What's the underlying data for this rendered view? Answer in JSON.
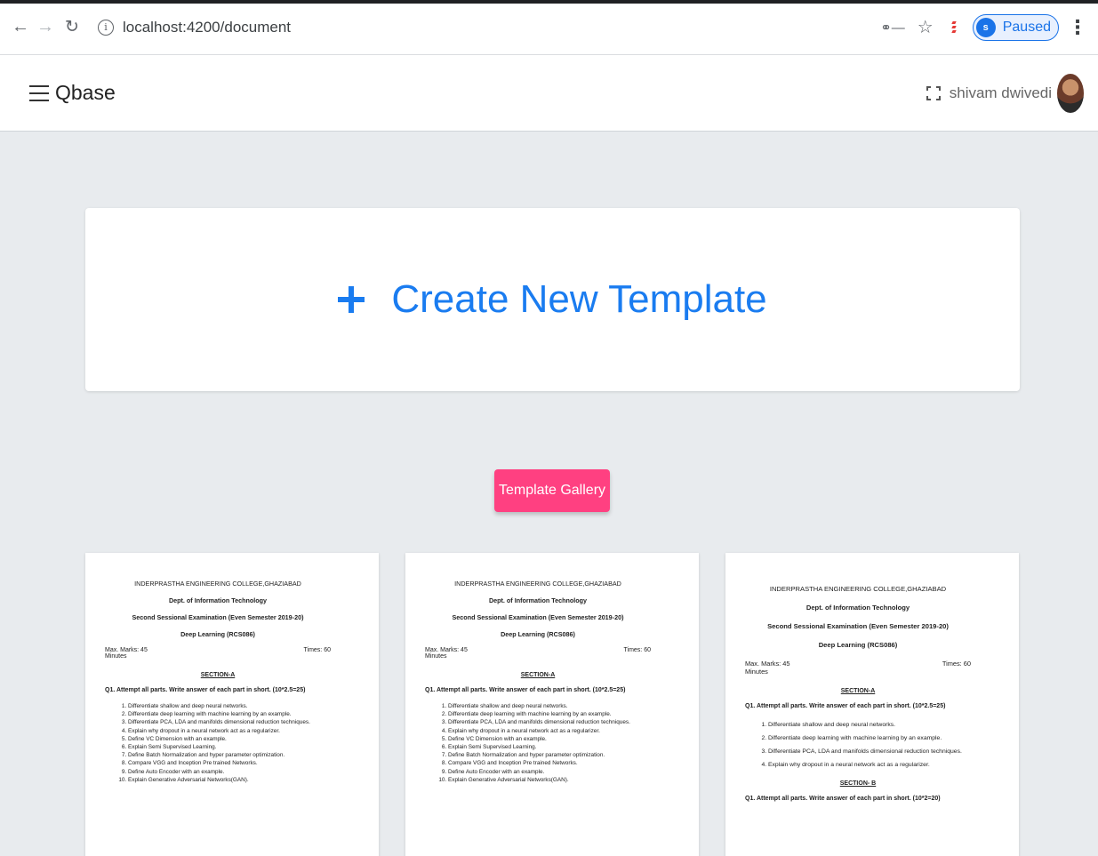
{
  "browser": {
    "url": "localhost:4200/document",
    "profile_initial": "s",
    "profile_status": "Paused"
  },
  "app": {
    "title": "Qbase",
    "user_name": "shivam dwivedi"
  },
  "create_card": {
    "label": "Create New Template"
  },
  "gallery": {
    "button_label": "Template Gallery"
  },
  "templates": [
    {
      "college": "INDERPRASTHA ENGINEERING COLLEGE,GHAZIABAD",
      "dept": "Dept. of Information Technology",
      "exam": "Second Sessional Examination (Even Semester 2019-20)",
      "subject": "Deep Learning (RCS086)",
      "max_marks": "Max. Marks: 45",
      "times": "Times: 60",
      "minutes": "Minutes",
      "section": "SECTION-A",
      "question": "Q1. Attempt all parts. Write answer of each part in short. (10*2.5=25)",
      "items": [
        "Differentiate shallow and deep neural networks.",
        "Differentiate deep learning with machine learning by an example.",
        "Differentiate PCA, LDA and manifolds dimensional reduction techniques.",
        "Explain why dropout in a neural network act as a regularizer.",
        "Define VC Dimension with an example.",
        "Explain Semi Supervised Learning.",
        "Define Batch Normalization and hyper parameter optimization.",
        "Compare VGG and Inception Pre trained Networks.",
        "Define Auto Encoder with an example.",
        "Explain Generative Adversarial Networks(GAN)."
      ]
    },
    {
      "college": "INDERPRASTHA ENGINEERING COLLEGE,GHAZIABAD",
      "dept": "Dept. of Information Technology",
      "exam": "Second Sessional Examination (Even Semester 2019-20)",
      "subject": "Deep Learning (RCS086)",
      "max_marks": "Max. Marks: 45",
      "times": "Times: 60",
      "minutes": "Minutes",
      "section": "SECTION-A",
      "question": "Q1. Attempt all parts. Write answer of each part in short. (10*2.5=25)",
      "items": [
        "Differentiate shallow and deep neural networks.",
        "Differentiate deep learning with machine learning by an example.",
        "Differentiate PCA, LDA and manifolds dimensional reduction techniques.",
        "Explain why dropout in a neural network act as a regularizer.",
        "Define VC Dimension with an example.",
        "Explain Semi Supervised Learning.",
        "Define Batch Normalization and hyper parameter optimization.",
        "Compare VGG and Inception Pre trained Networks.",
        "Define Auto Encoder with an example.",
        "Explain Generative Adversarial Networks(GAN)."
      ]
    },
    {
      "college": "INDERPRASTHA ENGINEERING COLLEGE,GHAZIABAD",
      "dept": "Dept. of Information Technology",
      "exam": "Second Sessional Examination (Even Semester 2019-20)",
      "subject": "Deep Learning (RCS086)",
      "max_marks": "Max. Marks: 45",
      "times": "Times: 60",
      "minutes": "Minutes",
      "section": "SECTION-A",
      "question": "Q1. Attempt all parts. Write answer of each part in short. (10*2.5=25)",
      "items": [
        "Differentiate shallow and deep neural networks.",
        "Differentiate deep learning with machine learning by an example.",
        "Differentiate PCA, LDA and manifolds dimensional reduction techniques.",
        "Explain why dropout in a neural network act as a regularizer."
      ],
      "section_b": "SECTION- B",
      "question_b": "Q1. Attempt all parts. Write answer of each part in short. (10*2=20)"
    }
  ]
}
